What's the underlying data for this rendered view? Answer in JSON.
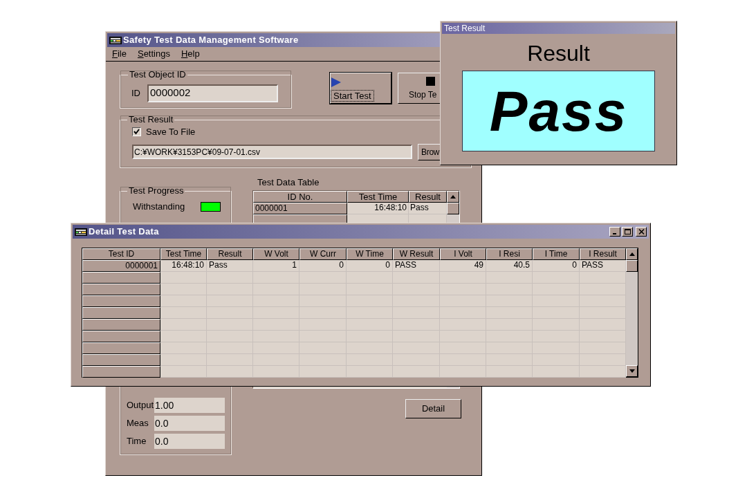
{
  "main_window": {
    "title": "Safety Test Data Management Software",
    "menu": [
      "File",
      "Settings",
      "Help"
    ],
    "test_object_id": {
      "label": "Test Object ID",
      "field_label": "ID",
      "value": "0000002"
    },
    "buttons": [
      {
        "kind": "start",
        "label": "Start Test"
      },
      {
        "kind": "stop",
        "label": "Stop Te"
      }
    ],
    "test_result": {
      "label": "Test Result",
      "save_to_file": {
        "label": "Save To File",
        "checked": true
      },
      "path": "C:¥WORK¥3153PC¥09-07-01.csv",
      "browse_button": "Brow"
    },
    "test_progress": {
      "label": "Test Progress",
      "indicators": [
        {
          "label": "Withstanding",
          "on": true
        }
      ],
      "readings": [
        {
          "label": "Output",
          "value": "1.00"
        },
        {
          "label": "Meas",
          "value": "0.0"
        },
        {
          "label": "Time",
          "value": "0.0"
        }
      ]
    },
    "test_data_table": {
      "title": "Test Data Table",
      "columns": [
        {
          "label": "ID No.",
          "kind": "text"
        },
        {
          "label": "Test Time",
          "kind": "number"
        },
        {
          "label": "Result",
          "kind": "text"
        }
      ],
      "rows": [
        [
          "0000001",
          "16:48:10",
          "Pass"
        ]
      ]
    },
    "detail_button": "Detail"
  },
  "result_window": {
    "title": "Test Result",
    "heading": "Result",
    "verdict": "Pass"
  },
  "detail_window": {
    "title": "Detail Test Data",
    "columns": [
      {
        "label": "Test ID",
        "kind": "number"
      },
      {
        "label": "Test Time",
        "kind": "number"
      },
      {
        "label": "Result",
        "kind": "text"
      },
      {
        "label": "W Volt",
        "kind": "number"
      },
      {
        "label": "W Curr",
        "kind": "number"
      },
      {
        "label": "W Time",
        "kind": "number"
      },
      {
        "label": "W Result",
        "kind": "text"
      },
      {
        "label": "I Volt",
        "kind": "number"
      },
      {
        "label": "I Resi",
        "kind": "number"
      },
      {
        "label": "I Time",
        "kind": "number"
      },
      {
        "label": "I Result",
        "kind": "text"
      }
    ],
    "rows": [
      [
        "0000001",
        "16:48:10",
        "Pass",
        "1",
        "0",
        "0",
        "PASS",
        "49",
        "40.5",
        "0",
        "PASS"
      ]
    ]
  }
}
